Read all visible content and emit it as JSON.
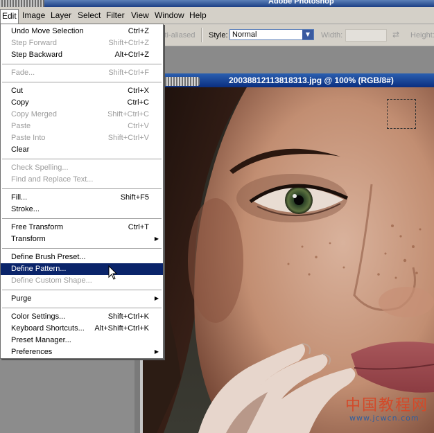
{
  "app": {
    "title": "Adobe Photoshop"
  },
  "menubar": {
    "items": [
      "Edit",
      "Image",
      "Layer",
      "Select",
      "Filter",
      "View",
      "Window",
      "Help"
    ]
  },
  "options": {
    "anti_aliased_label": "Anti-aliased",
    "style_label": "Style:",
    "style_value": "Normal",
    "width_label": "Width:",
    "height_label": "Height:"
  },
  "document": {
    "title": "20038812113818313.jpg @ 100% (RGB/8#)"
  },
  "edit_menu": {
    "groups": [
      [
        {
          "label": "Undo Move Selection",
          "shortcut": "Ctrl+Z",
          "enabled": true
        },
        {
          "label": "Step Forward",
          "shortcut": "Shift+Ctrl+Z",
          "enabled": false
        },
        {
          "label": "Step Backward",
          "shortcut": "Alt+Ctrl+Z",
          "enabled": true
        }
      ],
      [
        {
          "label": "Fade...",
          "shortcut": "Shift+Ctrl+F",
          "enabled": false
        }
      ],
      [
        {
          "label": "Cut",
          "shortcut": "Ctrl+X",
          "enabled": true
        },
        {
          "label": "Copy",
          "shortcut": "Ctrl+C",
          "enabled": true
        },
        {
          "label": "Copy Merged",
          "shortcut": "Shift+Ctrl+C",
          "enabled": false
        },
        {
          "label": "Paste",
          "shortcut": "Ctrl+V",
          "enabled": false
        },
        {
          "label": "Paste Into",
          "shortcut": "Shift+Ctrl+V",
          "enabled": false
        },
        {
          "label": "Clear",
          "shortcut": "",
          "enabled": true
        }
      ],
      [
        {
          "label": "Check Spelling...",
          "shortcut": "",
          "enabled": false
        },
        {
          "label": "Find and Replace Text...",
          "shortcut": "",
          "enabled": false
        }
      ],
      [
        {
          "label": "Fill...",
          "shortcut": "Shift+F5",
          "enabled": true
        },
        {
          "label": "Stroke...",
          "shortcut": "",
          "enabled": true
        }
      ],
      [
        {
          "label": "Free Transform",
          "shortcut": "Ctrl+T",
          "enabled": true
        },
        {
          "label": "Transform",
          "shortcut": "",
          "enabled": true,
          "submenu": true
        }
      ],
      [
        {
          "label": "Define Brush Preset...",
          "shortcut": "",
          "enabled": true
        },
        {
          "label": "Define Pattern...",
          "shortcut": "",
          "enabled": true,
          "highlighted": true
        },
        {
          "label": "Define Custom Shape...",
          "shortcut": "",
          "enabled": false
        }
      ],
      [
        {
          "label": "Purge",
          "shortcut": "",
          "enabled": true,
          "submenu": true
        }
      ],
      [
        {
          "label": "Color Settings...",
          "shortcut": "Shift+Ctrl+K",
          "enabled": true
        },
        {
          "label": "Keyboard Shortcuts...",
          "shortcut": "Alt+Shift+Ctrl+K",
          "enabled": true
        },
        {
          "label": "Preset Manager...",
          "shortcut": "",
          "enabled": true
        },
        {
          "label": "Preferences",
          "shortcut": "",
          "enabled": true,
          "submenu": true
        }
      ]
    ]
  },
  "watermark": {
    "main": "中国教程网",
    "url": "www.jcwcn.com"
  },
  "colors": {
    "menu_highlight": "#0a246a",
    "titlebar": "#1c3f86",
    "watermark_red": "#d24a2a"
  }
}
